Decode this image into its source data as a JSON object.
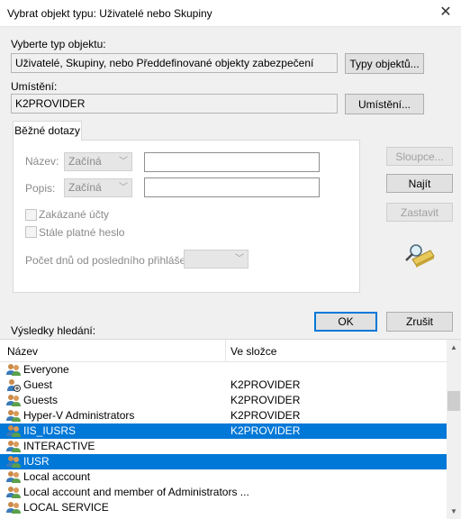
{
  "window": {
    "title": "Vybrat objekt typu: Uživatelé nebo Skupiny",
    "close": "✕"
  },
  "object_type": {
    "label": "Vyberte typ objektu:",
    "value": "Uživatelé, Skupiny, nebo Předdefinované objekty zabezpečení",
    "button": "Typy objektů..."
  },
  "location": {
    "label": "Umístění:",
    "value": "K2PROVIDER",
    "button": "Umístění..."
  },
  "queries": {
    "tab": "Běžné dotazy",
    "name_label": "Název:",
    "name_combo": "Začíná",
    "desc_label": "Popis:",
    "desc_combo": "Začíná",
    "disabled_accounts": "Zakázané účty",
    "non_expiring": "Stále platné heslo",
    "days_label": "Počet dnů od posledního přihlášení:"
  },
  "side_buttons": {
    "columns": "Sloupce...",
    "find": "Najít",
    "stop": "Zastavit"
  },
  "actions": {
    "ok": "OK",
    "cancel": "Zrušit"
  },
  "results": {
    "label": "Výsledky hledání:",
    "columns": [
      "Název",
      "Ve složce"
    ],
    "rows": [
      {
        "name": "Everyone",
        "folder": "",
        "icon": "group-icon",
        "selected": false
      },
      {
        "name": "Guest",
        "folder": "K2PROVIDER",
        "icon": "disabled-user-icon",
        "selected": false
      },
      {
        "name": "Guests",
        "folder": "K2PROVIDER",
        "icon": "group-icon",
        "selected": false
      },
      {
        "name": "Hyper-V Administrators",
        "folder": "K2PROVIDER",
        "icon": "group-icon",
        "selected": false
      },
      {
        "name": "IIS_IUSRS",
        "folder": "K2PROVIDER",
        "icon": "group-icon",
        "selected": true
      },
      {
        "name": "INTERACTIVE",
        "folder": "",
        "icon": "group-icon",
        "selected": false
      },
      {
        "name": "IUSR",
        "folder": "",
        "icon": "group-icon",
        "selected": true
      },
      {
        "name": "Local account",
        "folder": "",
        "icon": "group-icon",
        "selected": false
      },
      {
        "name": "Local account and member of Administrators ...",
        "folder": "",
        "icon": "group-icon",
        "selected": false
      },
      {
        "name": "LOCAL SERVICE",
        "folder": "",
        "icon": "group-icon",
        "selected": false
      }
    ]
  },
  "colors": {
    "selection": "#0078d7",
    "dialog_bg": "#f0f0f0"
  }
}
